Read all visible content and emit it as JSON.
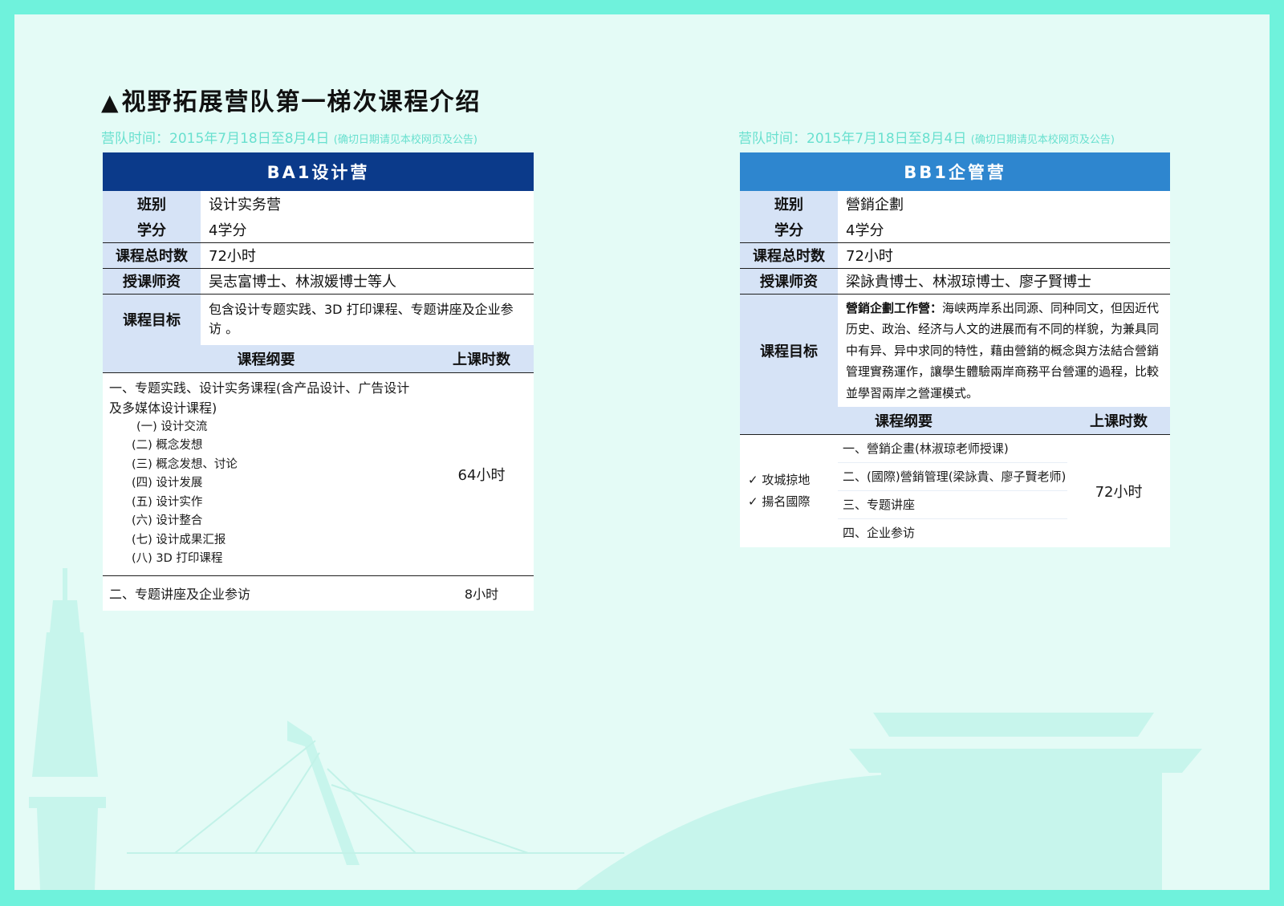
{
  "page": {
    "title_symbol": "▲",
    "title": "视野拓展营队第一梯次课程介绍",
    "camp_time_main": "营队时间：2015年7月18日至8月4日",
    "camp_time_note": "(确切日期请见本校网页及公告)"
  },
  "colors": {
    "frame": "#6ff2dc",
    "page_bg": "#e4fbf6",
    "header_dark": "#0b3a8a",
    "header_light": "#2e86cf",
    "label_bg": "#d6e3f6",
    "subtitle": "#69e0cf"
  },
  "left_card": {
    "header": "BA1设计营",
    "rows": [
      {
        "label": "班别",
        "value": "设计实务营"
      },
      {
        "label": "学分",
        "value": "4学分"
      },
      {
        "label": "课程总时数",
        "value": "72小时"
      },
      {
        "label": "授课师资",
        "value": "吴志富博士、林淑媛博士等人"
      },
      {
        "label": "课程目标",
        "value": "包含设计专题实践、3D 打印课程、专题讲座及企业参访 。"
      }
    ],
    "outline_header": "课程纲要",
    "hours_header": "上课时数",
    "outline": {
      "main": "一、专题实践、设计实务课程(含产品设计、广告设计及多媒体设计课程)",
      "subs": [
        "(一) 设计交流",
        "(二) 概念发想",
        "(三) 概念发想、讨论",
        "(四) 设计发展",
        "(五) 设计实作",
        "(六) 设计整合",
        "(七) 设计成果汇报",
        "(八) 3D 打印课程"
      ],
      "hours": "64小时",
      "second": "二、专题讲座及企业参访",
      "second_hours": "8小时"
    }
  },
  "right_card": {
    "header": "BB1企管营",
    "rows": [
      {
        "label": "班别",
        "value": "營銷企劃"
      },
      {
        "label": "学分",
        "value": "4学分"
      },
      {
        "label": "课程总时数",
        "value": "72小时"
      },
      {
        "label": "授课师资",
        "value": "梁詠貴博士、林淑琼博士、廖子賢博士"
      }
    ],
    "goal_label": "课程目标",
    "goal_lead": "營銷企劃工作營：",
    "goal_text": "海峡两岸系出同源、同种同文，但因近代历史、政治、经济与人文的进展而有不同的样貌，为兼具同中有异、异中求同的特性，藉由營銷的概念與方法結合營銷管理實務運作，讓學生體驗兩岸商務平台營運的過程，比較並學習兩岸之營運模式。",
    "outline_header": "课程纲要",
    "hours_header": "上课时数",
    "checks": [
      "✓ 攻城掠地",
      "✓ 揚名國際"
    ],
    "outline_items": [
      "一、營銷企畫(林淑琼老师授课)",
      "二、(國際)營銷管理(梁詠貴、廖子賢老师)",
      "三、专题讲座",
      "四、企业参访"
    ],
    "hours": "72小时"
  }
}
